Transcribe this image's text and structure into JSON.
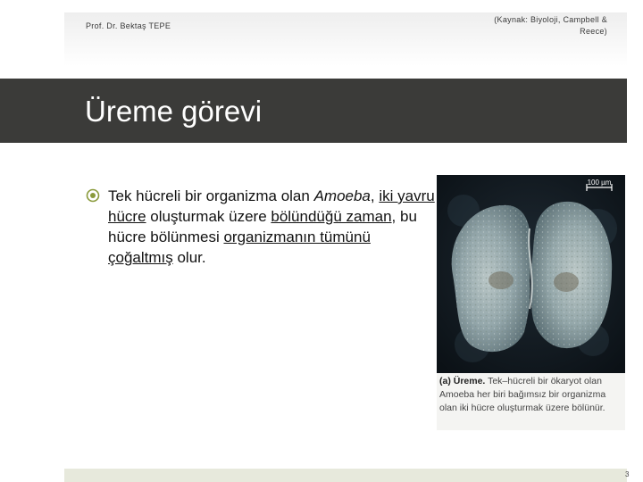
{
  "header": {
    "author": "Prof. Dr. Bektaş TEPE",
    "source": "(Kaynak: Biyoloji, Campbell & Reece)"
  },
  "slide": {
    "title": "Üreme görevi",
    "bullet": {
      "part1": "Tek hücreli bir organizma olan ",
      "italic": "Amoeba",
      "part2": ", ",
      "underline1": "iki yavru hücre",
      "part3": " oluşturmak üzere ",
      "underline2": "bölündüğü zaman",
      "part4": ", bu hücre bölünmesi ",
      "underline3": "organizmanın tümünü çoğaltmış",
      "part5": " olur."
    }
  },
  "figure": {
    "scale_label": "100 µm",
    "caption_label": "(a) Üreme.",
    "caption_text": "Tek–hücreli bir ökaryot olan Amoeba her biri bağımsız bir organizma olan iki hücre oluşturmak üzere bölünür."
  },
  "footer": {
    "page_number": "3"
  },
  "colors": {
    "title_bar": "#3b3b39",
    "footer_strip": "#e7e9dc",
    "bullet_icon": "#8a9a3c"
  }
}
